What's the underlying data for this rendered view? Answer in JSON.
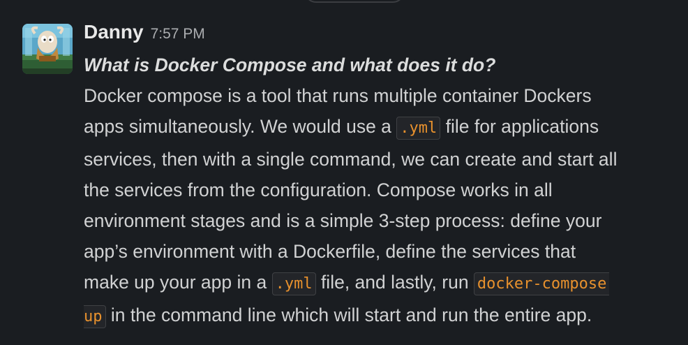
{
  "message": {
    "sender": "Danny",
    "time": "7:57 PM",
    "avatar_icon": "cartoon-character-avatar",
    "question": "What is Docker Compose and what does it do?",
    "lines": {
      "l1": "Docker compose is a tool that runs multiple container Dockers",
      "l2a": "apps simultaneously. We would use a ",
      "l2code": ".yml",
      "l2b": " file for applications",
      "l3": "services, then with a single command, we can create and start all",
      "l4": "the services from the configuration. Compose works in all",
      "l5": "environment stages and is a simple 3-step process: define your",
      "l6": "app’s environment with a Dockerfile, define the services that",
      "l7a": "make up your app in a ",
      "l7code": ".yml",
      "l7b": " file,  and lastly, run ",
      "l7code2": "docker-compose",
      "l8code": "up",
      "l8b": " in the command line which will start and run the entire app."
    }
  },
  "colors": {
    "background": "#1a1d21",
    "text": "#d1d2d3",
    "code": "#e8912d"
  }
}
